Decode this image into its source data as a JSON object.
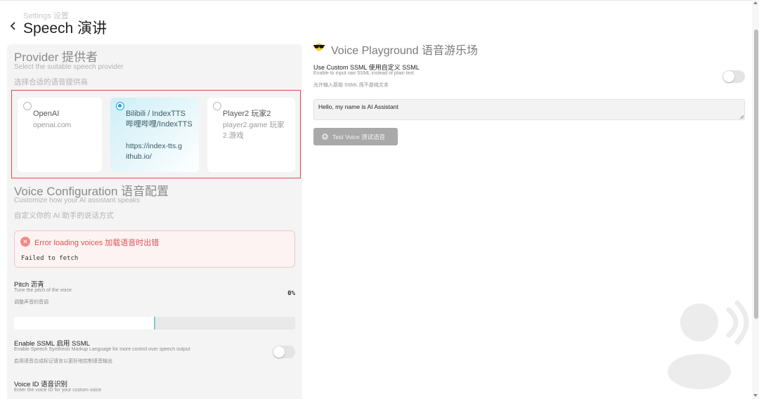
{
  "header": {
    "breadcrumb": "Settings  设置",
    "title": "Speech  演讲"
  },
  "provider": {
    "title": "Provider  提供者",
    "subtitle_en": "Select the suitable speech provider",
    "subtitle_zh": "选择合适的语音提供商",
    "cards": [
      {
        "name": "OpenAI",
        "url": "openai.com",
        "selected": false
      },
      {
        "name": "Bilibili / IndexTTS  哔哩哔哩/IndexTTS",
        "url": "https://index-tts.github.io/",
        "selected": true
      },
      {
        "name": "Player2  玩家2",
        "url": "player2.game  玩家2.游戏",
        "selected": false
      }
    ]
  },
  "voice_config": {
    "title": "Voice Configuration  语音配置",
    "subtitle_en": "Customize how your AI assistant speaks",
    "subtitle_zh": "自定义你的 AI 助手的说话方式",
    "error_title": "Error loading voices  加载语音时出错",
    "error_message": "Failed to fetch",
    "pitch": {
      "label": "Pitch  沥青",
      "desc_en": "Tune the pitch of the voice",
      "desc_zh": "调整声音的音调",
      "value_text": "0%",
      "slider_fraction": 0.5
    },
    "ssml": {
      "label": "Enable SSML  启用 SSML",
      "desc_en": "Enable Speech Synthesis Markup Language for more control over speech output",
      "desc_zh": "启用语音合成标记语言以更好地控制语音输出",
      "enabled": false
    },
    "voice_id": {
      "label": "Voice ID  语音识别",
      "desc_en": "Enter the voice ID for your custom voice"
    }
  },
  "playground": {
    "icon": "sunglasses-icon",
    "title": "Voice Playground  语音游乐场",
    "custom_ssml_label": "Use Custom SSML  使用自定义 SSML",
    "custom_ssml_desc_en": "Enable to input raw SSML instead of plain text",
    "custom_ssml_desc_zh": "允许输入原始 SSML 而不是纯文本",
    "custom_ssml_enabled": false,
    "input_value": "Hello, my name is AI Assistant",
    "test_button": "Test Voice  测试语音"
  },
  "colors": {
    "accent": "#1aa3d9",
    "error": "#e05252",
    "selection_outline": "#e0474c"
  }
}
